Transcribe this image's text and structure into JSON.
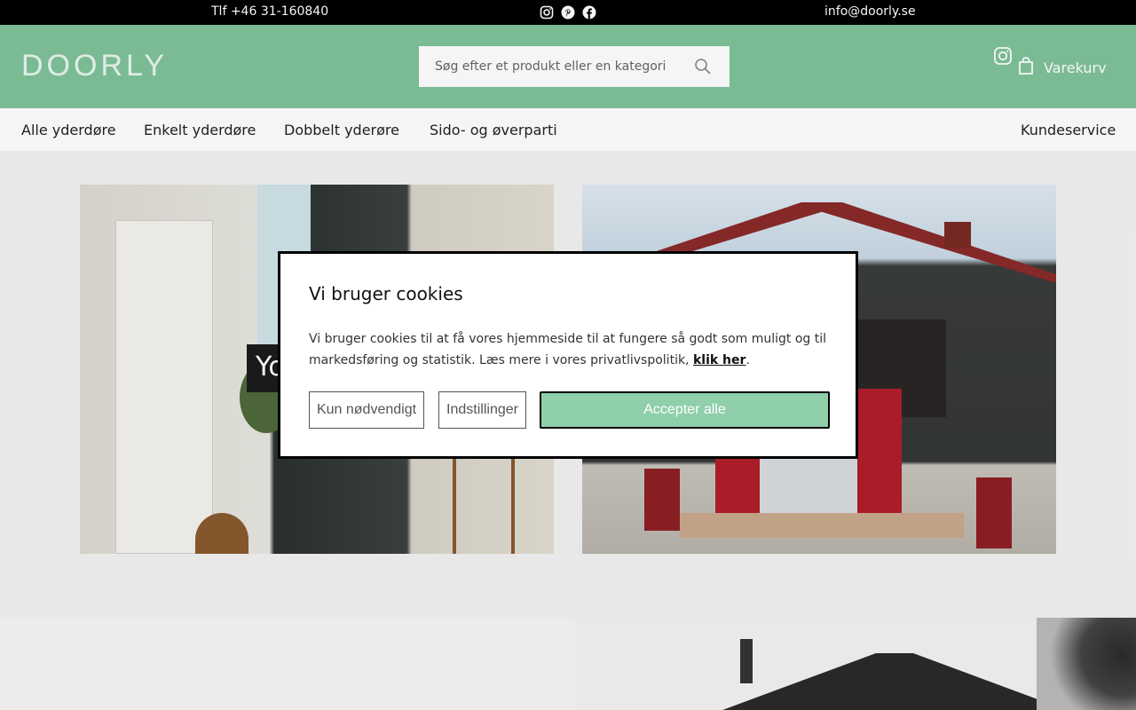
{
  "topbar": {
    "phone": "Tlf +46 31-160840",
    "email": "info@doorly.se"
  },
  "header": {
    "logo": "DOORLY",
    "search_placeholder": "Søg efter et produkt eller en kategori",
    "cart_label": "Varekurv"
  },
  "nav": {
    "items": [
      "Alle yderdøre",
      "Enkelt yderdøre",
      "Dobbelt yderøre",
      "Sido- og øverparti"
    ],
    "customer_service": "Kundeservice"
  },
  "hero": {
    "overlay_text": "Yo"
  },
  "cookie": {
    "title": "Vi bruger cookies",
    "body": "Vi bruger cookies til at få vores hjemmeside til at fungere så godt som muligt og til markedsføring og statistik. Læs mere i vores privatlivspolitik, ",
    "link": "klik her",
    "period": ".",
    "btn_necessary": "Kun nødvendigt",
    "btn_settings": "Indstillinger",
    "btn_accept": "Accepter alle"
  },
  "colors": {
    "header_green": "#7fc39b",
    "accept_green": "#8fcfaa",
    "topbar": "#000000"
  },
  "icons": [
    "instagram-icon",
    "pinterest-icon",
    "facebook-icon",
    "search-icon",
    "bag-icon"
  ]
}
